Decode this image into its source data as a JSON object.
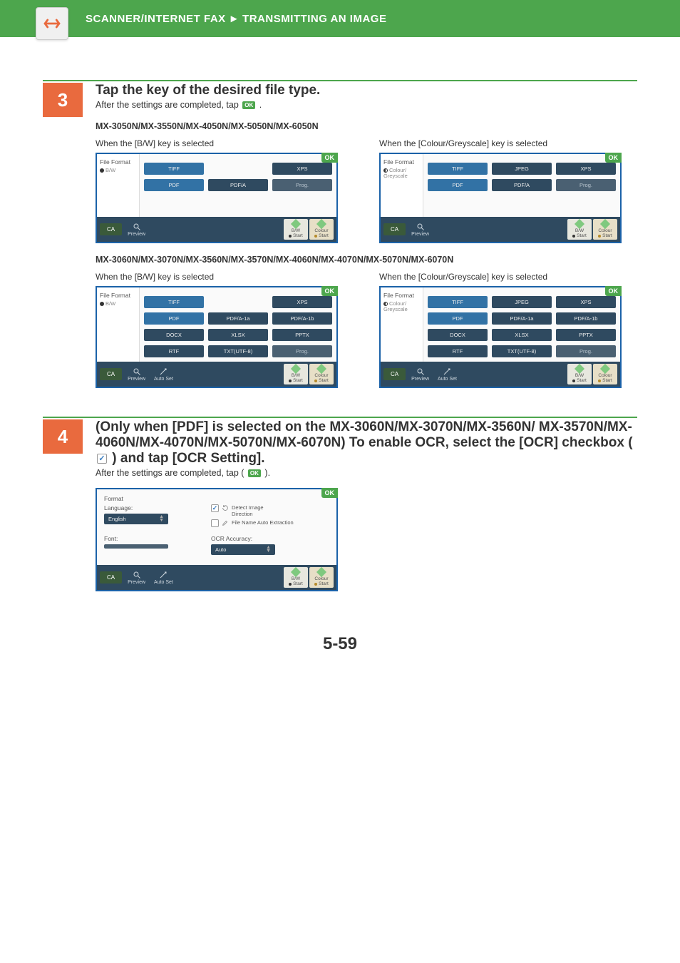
{
  "header": {
    "breadcrumb1": "SCANNER/INTERNET FAX",
    "sep": "►",
    "breadcrumb2": "TRANSMITTING AN IMAGE"
  },
  "step3": {
    "num": "3",
    "title": "Tap the key of the desired file type.",
    "subtext_pre": "After the settings are completed, tap ",
    "ok_inline": "OK",
    "subtext_post": " .",
    "models1": "MX-3050N/MX-3550N/MX-4050N/MX-5050N/MX-6050N",
    "bw_label": "When the [B/W] key is selected",
    "color_label": "When the [Colour/Greyscale] key is selected",
    "models2": "MX-3060N/MX-3070N/MX-3560N/MX-3570N/MX-4060N/MX-4070N/MX-5070N/MX-6070N"
  },
  "panel_common": {
    "file_format": "File Format",
    "bw": "B/W",
    "colour_grey": "Colour/\nGreyscale",
    "ok": "OK",
    "ca": "CA",
    "preview": "Preview",
    "autoset": "Auto Set",
    "bw_start1": "B/W",
    "bw_start2": "Start",
    "col_start1": "Colour",
    "col_start2": "Start"
  },
  "panelA_bw": {
    "buttons": [
      "TIFF",
      "",
      "XPS",
      "PDF",
      "PDF/A",
      "Prog."
    ]
  },
  "panelA_col": {
    "buttons": [
      "TIFF",
      "JPEG",
      "XPS",
      "PDF",
      "PDF/A",
      "Prog."
    ]
  },
  "panelB_bw": {
    "buttons": [
      "TIFF",
      "",
      "XPS",
      "PDF",
      "PDF/A-1a",
      "PDF/A-1b",
      "DOCX",
      "XLSX",
      "PPTX",
      "RTF",
      "TXT(UTF-8)",
      "Prog."
    ]
  },
  "panelB_col": {
    "buttons": [
      "TIFF",
      "JPEG",
      "XPS",
      "PDF",
      "PDF/A-1a",
      "PDF/A-1b",
      "DOCX",
      "XLSX",
      "PPTX",
      "RTF",
      "TXT(UTF-8)",
      "Prog."
    ]
  },
  "step4": {
    "num": "4",
    "title": "(Only when [PDF] is selected on the MX-3060N/MX-3070N/MX-3560N/ MX-3570N/MX-4060N/MX-4070N/MX-5070N/MX-6070N)  To enable OCR, select the [OCR] checkbox (",
    "title_post": ") and tap [OCR Setting].",
    "subtext_pre": "After the settings are completed, tap ( ",
    "ok_inline": "OK",
    "subtext_post": " )."
  },
  "fmt_panel": {
    "format": "Format",
    "language": "Language:",
    "lang_val": "English",
    "font": "Font:",
    "ocr_acc": "OCR Accuracy:",
    "acc_val": "Auto",
    "chk1a": "Detect Image",
    "chk1b": "Direction",
    "chk2": "File Name Auto Extraction"
  },
  "page_number": "5-59"
}
